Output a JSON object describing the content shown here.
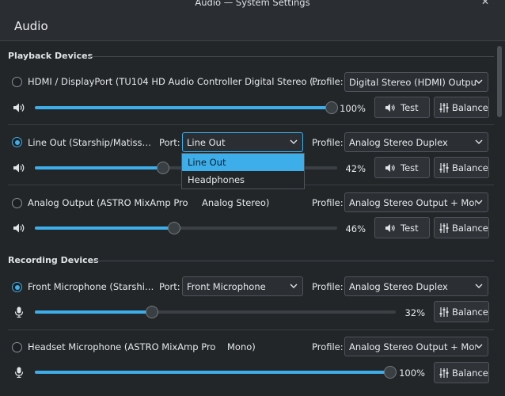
{
  "window": {
    "title": "Audio — System Settings",
    "minimize_glyph": "˅",
    "close_glyph": "✕"
  },
  "page": {
    "title": "Audio"
  },
  "playback": {
    "section_title": "Playback Devices"
  },
  "recording": {
    "section_title": "Recording Devices"
  },
  "labels": {
    "port": "Port:",
    "profile": "Profile:",
    "test": "Test",
    "balance": "Balance"
  },
  "devices": [
    {
      "name": "HDMI / DisplayPort (TU104 HD Audio Controller Digital Stereo (…",
      "selected": false,
      "profile": "Digital Stereo (HDMI) Output",
      "volume_text": "100%",
      "volume": 1.0,
      "icon": "speaker-icon"
    },
    {
      "name": "Line Out (Starship/Matiss…",
      "selected": true,
      "port": "Line Out",
      "profile": "Analog Stereo Duplex",
      "volume_text": "42%",
      "volume": 0.42,
      "icon": "speaker-icon"
    },
    {
      "name": "Analog Output (ASTRO MixAmp Pro",
      "name_suffix": "Analog Stereo)",
      "selected": false,
      "profile": "Analog Stereo Output + Mono I",
      "volume_text": "46%",
      "volume": 0.46,
      "icon": "speaker-icon"
    },
    {
      "name": "Front Microphone (Starshi…",
      "selected": true,
      "port": "Front Microphone",
      "profile": "Analog Stereo Duplex",
      "volume_text": "32%",
      "volume": 0.32,
      "icon": "microphone-icon"
    },
    {
      "name": "Headset Microphone (ASTRO MixAmp Pro",
      "name_suffix": "Mono)",
      "selected": false,
      "profile": "Analog Stereo Output + Mono I",
      "volume_text": "100%",
      "volume": 1.0,
      "icon": "microphone-icon"
    }
  ],
  "port_dropdown": {
    "options": [
      "Line Out",
      "Headphones"
    ],
    "highlighted": "Line Out"
  },
  "colors": {
    "accent": "#3daee9",
    "background": "#232629",
    "header": "#2a2e32"
  }
}
